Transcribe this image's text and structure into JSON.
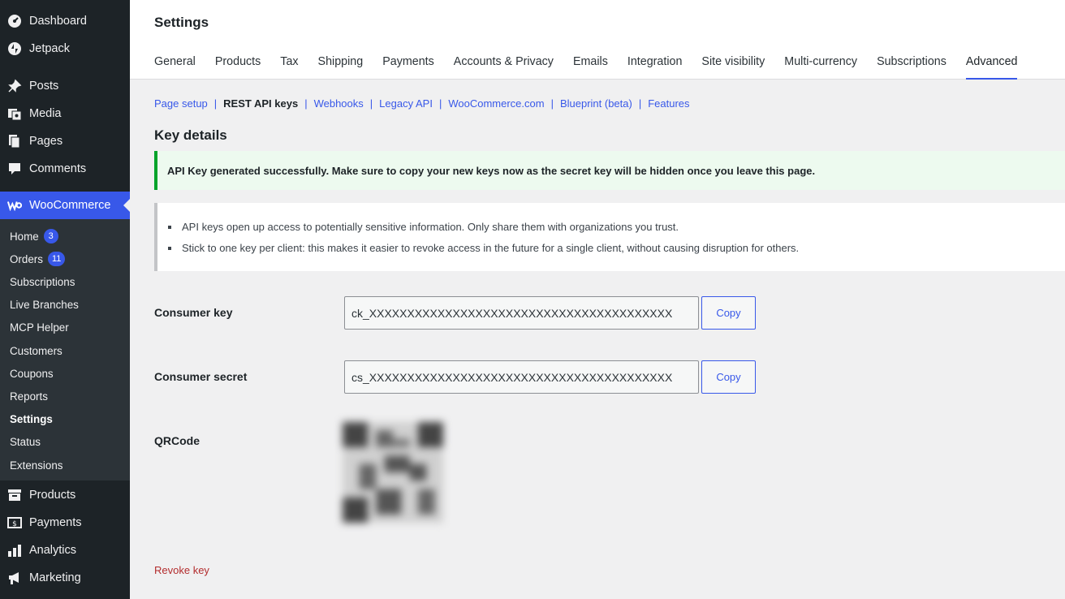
{
  "sidebar": {
    "top_items": [
      {
        "label": "Dashboard",
        "icon": "dashboard-icon"
      },
      {
        "label": "Jetpack",
        "icon": "jetpack-icon"
      },
      {
        "label": "Posts",
        "icon": "pin-icon"
      },
      {
        "label": "Media",
        "icon": "media-icon"
      },
      {
        "label": "Pages",
        "icon": "pages-icon"
      },
      {
        "label": "Comments",
        "icon": "comments-icon"
      },
      {
        "label": "WooCommerce",
        "icon": "woocommerce-icon"
      }
    ],
    "sub_items": [
      {
        "label": "Home",
        "badge": "3"
      },
      {
        "label": "Orders",
        "badge": "11"
      },
      {
        "label": "Subscriptions"
      },
      {
        "label": "Live Branches"
      },
      {
        "label": "MCP Helper"
      },
      {
        "label": "Customers"
      },
      {
        "label": "Coupons"
      },
      {
        "label": "Reports"
      },
      {
        "label": "Settings"
      },
      {
        "label": "Status"
      },
      {
        "label": "Extensions"
      }
    ],
    "bottom_items": [
      {
        "label": "Products",
        "icon": "archive-icon"
      },
      {
        "label": "Payments",
        "icon": "payments-icon"
      },
      {
        "label": "Analytics",
        "icon": "chart-bar-icon"
      },
      {
        "label": "Marketing",
        "icon": "megaphone-icon"
      }
    ]
  },
  "header": {
    "title": "Settings",
    "tabs": [
      "General",
      "Products",
      "Tax",
      "Shipping",
      "Payments",
      "Accounts & Privacy",
      "Emails",
      "Integration",
      "Site visibility",
      "Multi-currency",
      "Subscriptions",
      "Advanced"
    ]
  },
  "subnav": [
    "Page setup",
    "REST API keys",
    "Webhooks",
    "Legacy API",
    "WooCommerce.com",
    "Blueprint (beta)",
    "Features"
  ],
  "main": {
    "section_title": "Key details",
    "success_notice": "API Key generated successfully. Make sure to copy your new keys now as the secret key will be hidden once you leave this page.",
    "info_notes": [
      "API keys open up access to potentially sensitive information. Only share them with organizations you trust.",
      "Stick to one key per client: this makes it easier to revoke access in the future for a single client, without causing disruption for others."
    ],
    "consumer_key_label": "Consumer key",
    "consumer_key_value": "ck_XXXXXXXXXXXXXXXXXXXXXXXXXXXXXXXXXXXXXXXX",
    "consumer_secret_label": "Consumer secret",
    "consumer_secret_value": "cs_XXXXXXXXXXXXXXXXXXXXXXXXXXXXXXXXXXXXXXXX",
    "copy_label": "Copy",
    "qrcode_label": "QRCode",
    "revoke_label": "Revoke key"
  },
  "colors": {
    "accent": "#3858e9",
    "sidebar_bg": "#1d2327",
    "submenu_bg": "#2c3338",
    "success_border": "#00a32a",
    "danger": "#b32d2e"
  }
}
